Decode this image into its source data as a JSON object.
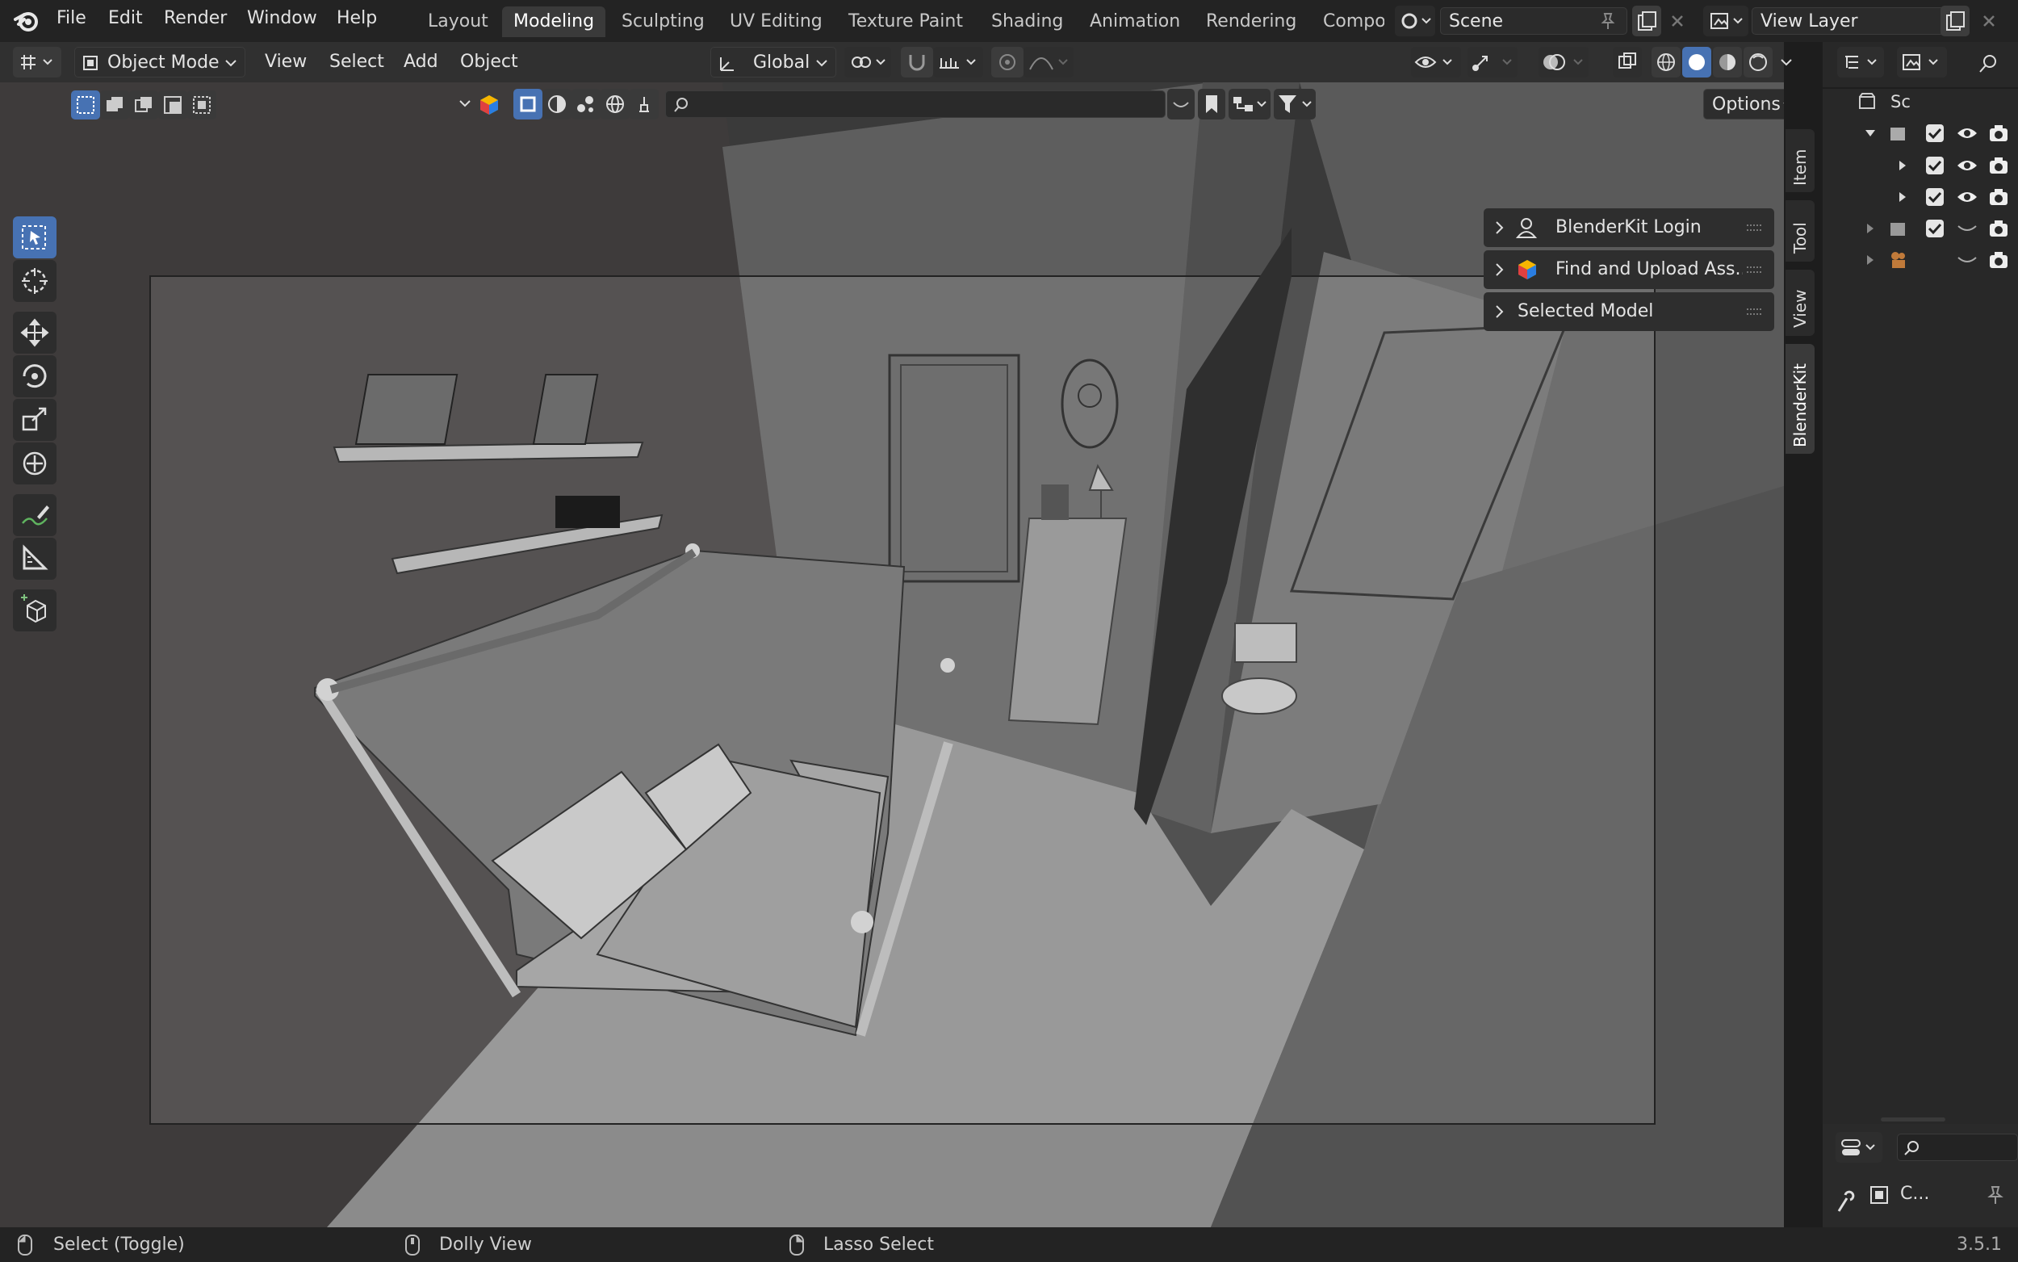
{
  "app": {
    "version": "3.5.1",
    "accent": "#4772b3"
  },
  "menu": [
    "File",
    "Edit",
    "Render",
    "Window",
    "Help"
  ],
  "workspaces": {
    "tabs": [
      "Layout",
      "Modeling",
      "Sculpting",
      "UV Editing",
      "Texture Paint",
      "Shading",
      "Animation",
      "Rendering",
      "Compo"
    ],
    "active": "Modeling"
  },
  "scene": {
    "name": "Scene"
  },
  "view_layer": {
    "name": "View Layer"
  },
  "header": {
    "mode": "Object Mode",
    "menus": [
      "View",
      "Select",
      "Add",
      "Object"
    ],
    "orientation": "Global"
  },
  "header3": {
    "options_label": "Options"
  },
  "npanel": {
    "rows": [
      "BlenderKit Login",
      "Find and Upload Ass...",
      "Selected Model"
    ]
  },
  "sidebar_tabs": [
    "Item",
    "Tool",
    "View",
    "BlenderKit"
  ],
  "outliner": {
    "root_label": "Sc"
  },
  "props": {
    "label": "C..."
  },
  "statusbar": {
    "left": "Select (Toggle)",
    "middle": "Dolly View",
    "right": "Lasso Select"
  },
  "icons": [
    "blender-logo",
    "select-box-tool",
    "cursor-tool",
    "move-tool",
    "rotate-tool",
    "scale-tool",
    "transform-tool",
    "annotate-tool",
    "measure-tool",
    "add-cube-tool",
    "eye-icon",
    "camera-icon",
    "checkbox-icon",
    "search-icon",
    "filter-icon",
    "pin-icon",
    "close-icon",
    "user-icon",
    "blenderkit-logo",
    "mouse-icon"
  ]
}
